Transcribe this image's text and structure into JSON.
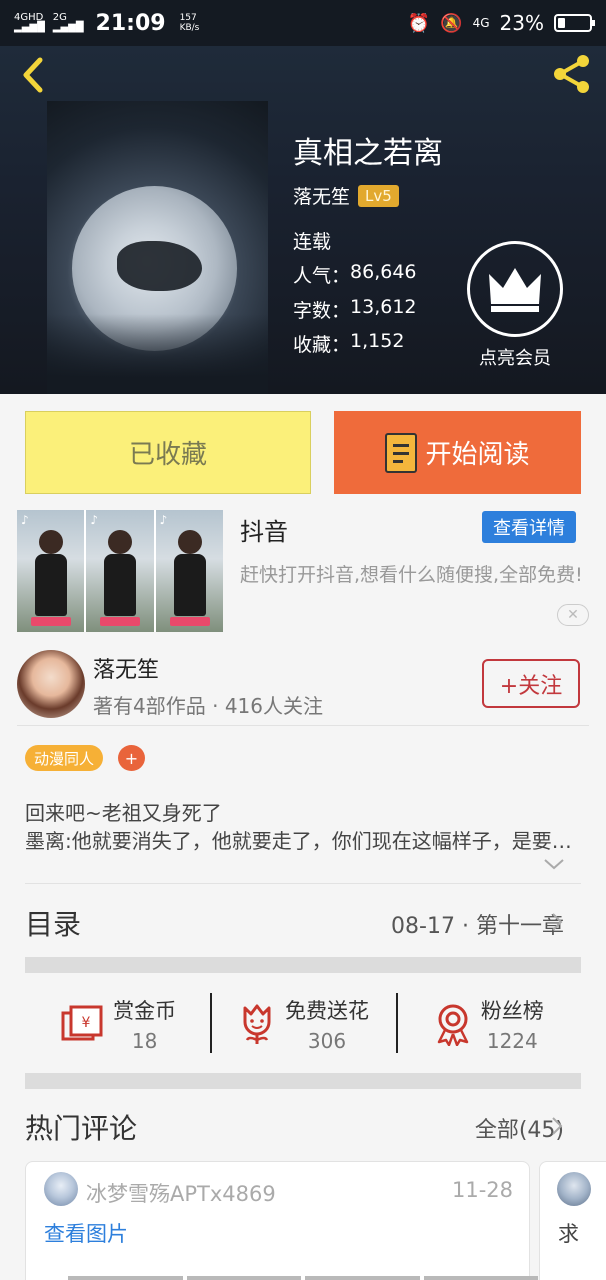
{
  "status_bar": {
    "network1": "4GHD",
    "network2": "2G",
    "time": "21:09",
    "speed_value": "157",
    "speed_unit": "KB/s",
    "network3": "4G",
    "battery_pct": "23%",
    "battery_level": 0.23
  },
  "book": {
    "title": "真相之若离",
    "author": "落无笙",
    "level": "Lv5",
    "status": "连载",
    "stats": [
      {
        "label": "人气：",
        "value": "86,646"
      },
      {
        "label": "字数：",
        "value": "13,612"
      },
      {
        "label": "收藏：",
        "value": "1,152"
      }
    ],
    "vip_label": "点亮会员"
  },
  "buttons": {
    "favorited": "已收藏",
    "start_reading": "开始阅读"
  },
  "ad": {
    "title": "抖音",
    "detail_button": "查看详情",
    "description": "赶快打开抖音,想看什么随便搜,全部免费!",
    "close": "✕"
  },
  "author_card": {
    "name": "落无笙",
    "works": "著有4部作品",
    "followers": "416人关注",
    "follow_button": "+关注"
  },
  "tags": {
    "category": "动漫同人",
    "add": "+"
  },
  "intro": {
    "line1": "回来吧~老祖又身死了",
    "line2": "墨离:他就要消失了，他就要走了，你们现在这幅样子，是要做什么？"
  },
  "toc": {
    "label": "目录",
    "date": "08-17",
    "sep": "·",
    "chapter": "第十一章"
  },
  "actions": [
    {
      "label": "赏金币",
      "count": "18",
      "icon": "red-envelope-icon"
    },
    {
      "label": "免费送花",
      "count": "306",
      "icon": "flower-icon"
    },
    {
      "label": "粉丝榜",
      "count": "1224",
      "icon": "medal-icon"
    }
  ],
  "comments": {
    "title": "热门评论",
    "all": "全部(45)",
    "items": [
      {
        "user": "冰梦雪殇APTx4869",
        "date": "11-28",
        "text": "查看图片"
      },
      {
        "text": "求"
      }
    ]
  },
  "colors": {
    "accent_orange": "#ef6b3b",
    "fav_yellow": "#fbf07a",
    "link_blue": "#2d7fdc",
    "follow_red": "#c2383d",
    "lv_gold": "#e2a92e"
  }
}
